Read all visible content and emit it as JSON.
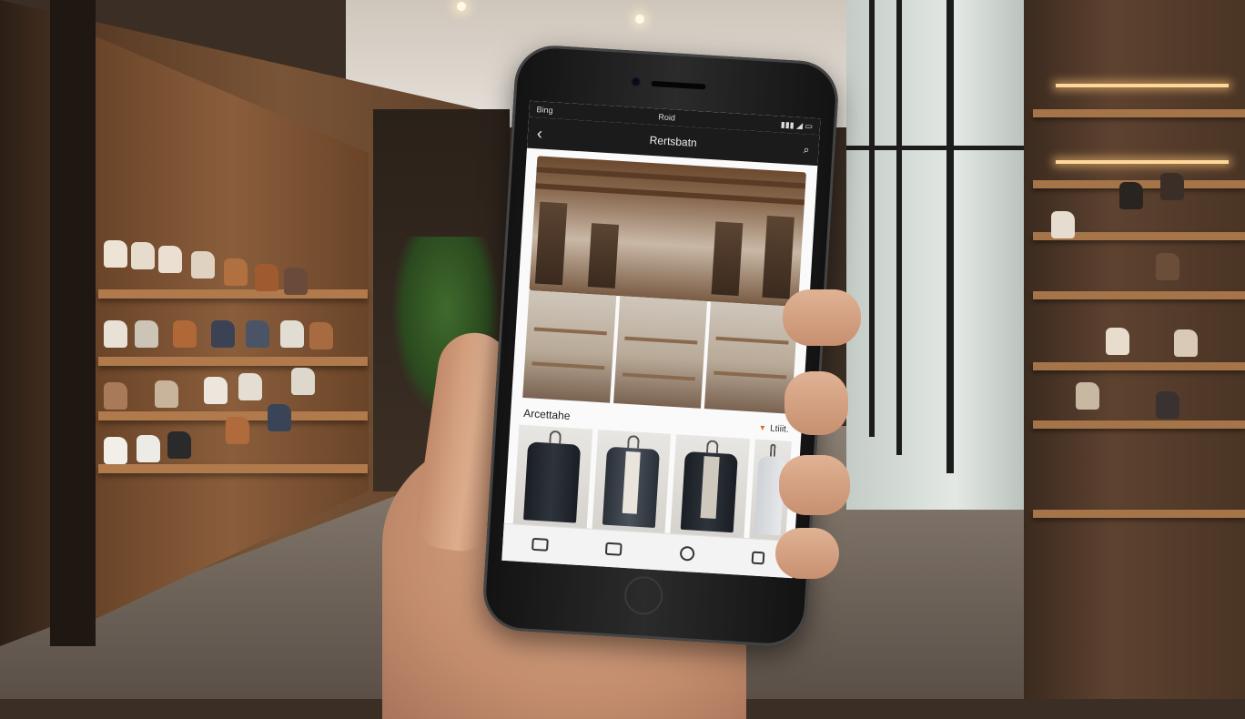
{
  "status_bar": {
    "left": "Bing",
    "center": "Roid",
    "right": "▮▮▮ ◢ ▭"
  },
  "nav": {
    "back_glyph": "‹",
    "title": "Rertsbatn",
    "action_glyph": "⌕"
  },
  "section": {
    "title": "Arcettahe",
    "more_tag": "▾",
    "more_label": "Ltiiit."
  },
  "tab_bar": {
    "items": [
      "home",
      "catalog",
      "profile",
      "cart"
    ]
  },
  "colors": {
    "accent": "#e06a2a",
    "screen_bg": "#fafafa",
    "nav_bg": "#1b1b1b"
  }
}
